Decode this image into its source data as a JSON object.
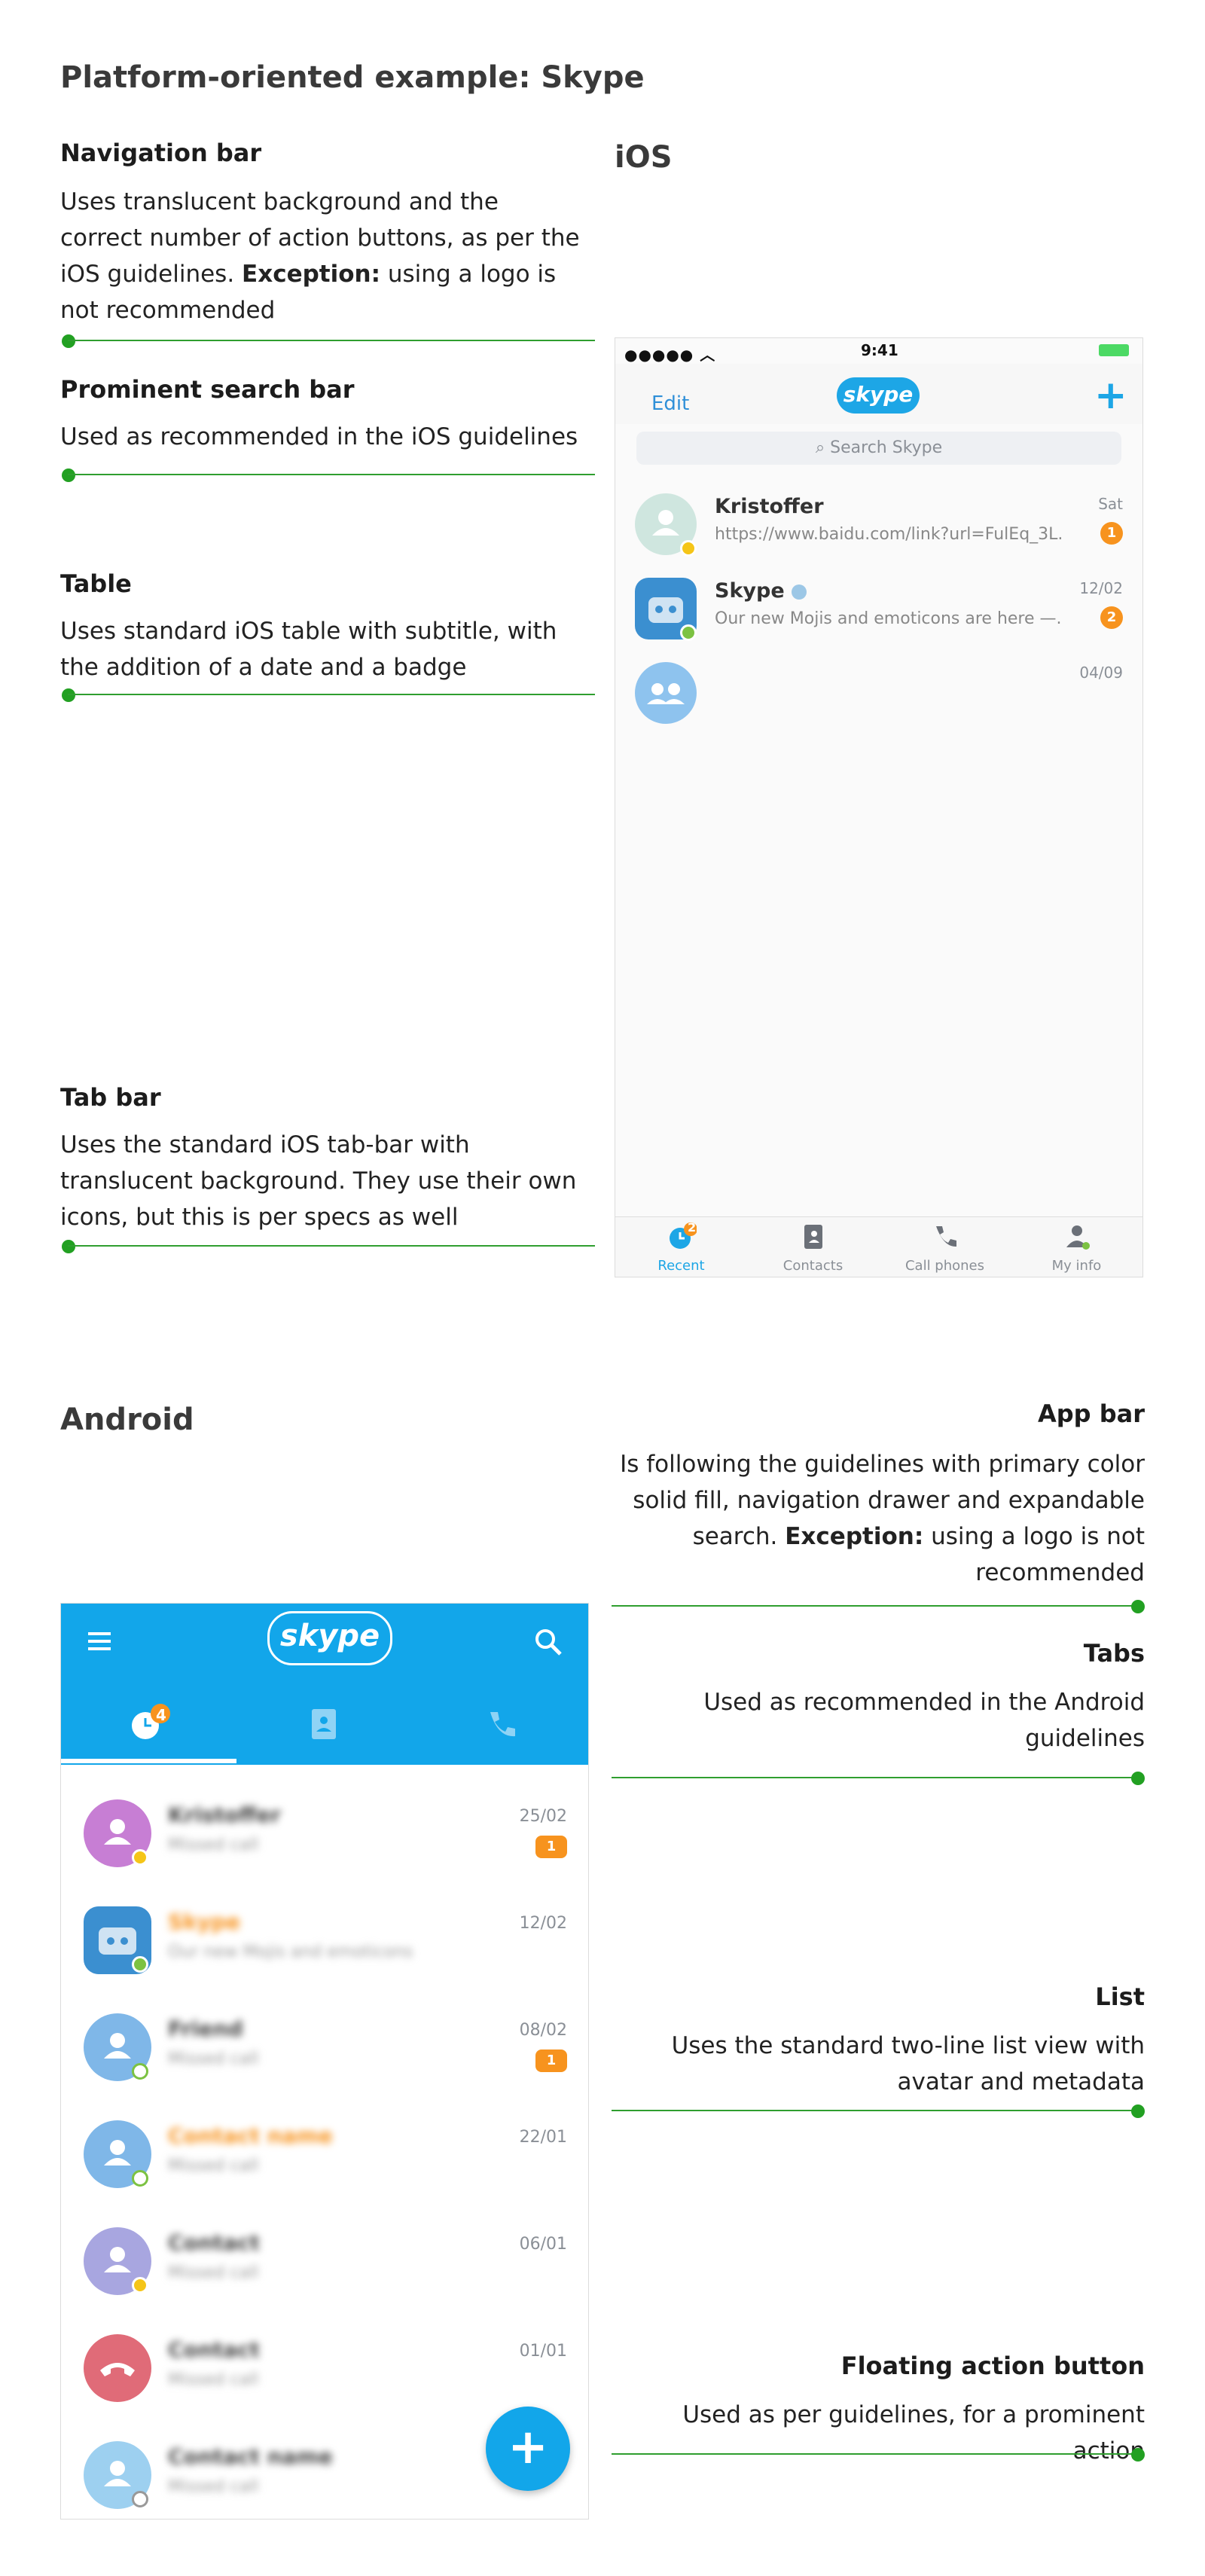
{
  "page_title": "Platform-oriented example: Skype",
  "ios_section": {
    "heading": "iOS",
    "annotations": [
      {
        "title": "Navigation bar",
        "body_pre": "Uses translucent background and the correct number of action buttons, as per the iOS guidelines. ",
        "body_bold": "Exception:",
        "body_post": " using a logo is not recommended"
      },
      {
        "title": "Prominent search bar",
        "body": "Used as recommended in the iOS guidelines"
      },
      {
        "title": "Table",
        "body": "Uses standard iOS table with subtitle, with the addition of a date and a badge"
      },
      {
        "title": "Tab bar",
        "body": "Uses the standard iOS tab-bar with translucent background. They use their own icons, but this is per specs as well"
      }
    ],
    "phone": {
      "status_time": "9:41",
      "nav_edit": "Edit",
      "logo": "skype",
      "nav_add_icon": "plus-icon",
      "search_placeholder": "Search Skype",
      "rows": [
        {
          "name": "Kristoffer",
          "subtitle": "https://www.baidu.com/link?url=FulEq_3L...",
          "date": "Sat",
          "badge": "1"
        },
        {
          "name": "Skype",
          "subtitle": "Our new Mojis and emoticons are here —...",
          "date": "12/02",
          "badge": "2"
        },
        {
          "name": "",
          "subtitle": "",
          "date": "04/09",
          "badge": ""
        }
      ],
      "tabs": [
        {
          "label": "Recent",
          "icon": "clock-icon",
          "badge": "2"
        },
        {
          "label": "Contacts",
          "icon": "contacts-icon"
        },
        {
          "label": "Call phones",
          "icon": "phone-icon"
        },
        {
          "label": "My info",
          "icon": "person-icon"
        }
      ]
    }
  },
  "android_section": {
    "heading": "Android",
    "annotations": [
      {
        "title": "App bar",
        "body_pre": "Is following the guidelines with primary color solid fill, navigation drawer and expandable search. ",
        "body_bold": "Exception:",
        "body_post": " using a logo is not recommended"
      },
      {
        "title": "Tabs",
        "body": "Used as recommended in the Android guidelines"
      },
      {
        "title": "List",
        "body": "Uses the standard two-line list view with avatar and metadata"
      },
      {
        "title": "Floating action button",
        "body": "Used as per guidelines, for a prominent action"
      }
    ],
    "phone": {
      "logo": "skype",
      "recent_badge": "4",
      "rows": [
        {
          "name": "Kristoffer",
          "subtitle": "Missed call",
          "date": "25/02",
          "badge": "1"
        },
        {
          "name": "Skype",
          "subtitle": "Our new Mojis and emoticons",
          "date": "12/02",
          "badge": ""
        },
        {
          "name": "Friend",
          "subtitle": "Missed call",
          "date": "08/02",
          "badge": "1"
        },
        {
          "name": "Contact name",
          "subtitle": "Missed call",
          "date": "22/01",
          "badge": ""
        },
        {
          "name": "Contact",
          "subtitle": "Missed call",
          "date": "06/01",
          "badge": ""
        },
        {
          "name": "Contact",
          "subtitle": "Missed call",
          "date": "01/01",
          "badge": ""
        },
        {
          "name": "Contact name",
          "subtitle": "Missed call",
          "date": "",
          "badge": ""
        }
      ],
      "fab_label": "+"
    }
  },
  "colors": {
    "accent_green": "#2f9e2f",
    "skype_blue": "#12a6ea",
    "badge_orange": "#f7931e"
  }
}
